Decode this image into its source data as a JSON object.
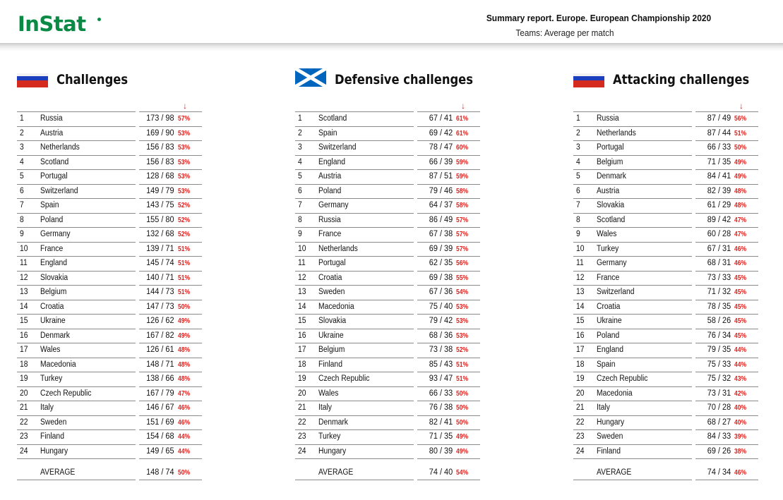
{
  "header": {
    "logo": "InStat",
    "title": "Summary report. Europe. European Championship 2020",
    "subtitle": "Teams: Average per match"
  },
  "colors": {
    "brand": "#0a8a44",
    "percent": "#e0201c",
    "rule": "#8a8a8a"
  },
  "sort_indicator": "↓",
  "panels": [
    {
      "title": "Challenges",
      "flag": "russia-flag",
      "rows": [
        {
          "rank": "1",
          "team": "Russia",
          "value": "173 / 98",
          "pct": "57%"
        },
        {
          "rank": "2",
          "team": "Austria",
          "value": "169 / 90",
          "pct": "53%"
        },
        {
          "rank": "3",
          "team": "Netherlands",
          "value": "156 / 83",
          "pct": "53%"
        },
        {
          "rank": "4",
          "team": "Scotland",
          "value": "156 / 83",
          "pct": "53%"
        },
        {
          "rank": "5",
          "team": "Portugal",
          "value": "128 / 68",
          "pct": "53%"
        },
        {
          "rank": "6",
          "team": "Switzerland",
          "value": "149 / 79",
          "pct": "53%"
        },
        {
          "rank": "7",
          "team": "Spain",
          "value": "143 / 75",
          "pct": "52%"
        },
        {
          "rank": "8",
          "team": "Poland",
          "value": "155 / 80",
          "pct": "52%"
        },
        {
          "rank": "9",
          "team": "Germany",
          "value": "132 / 68",
          "pct": "52%"
        },
        {
          "rank": "10",
          "team": "France",
          "value": "139 / 71",
          "pct": "51%"
        },
        {
          "rank": "11",
          "team": "England",
          "value": "145 / 74",
          "pct": "51%"
        },
        {
          "rank": "12",
          "team": "Slovakia",
          "value": "140 / 71",
          "pct": "51%"
        },
        {
          "rank": "13",
          "team": "Belgium",
          "value": "144 / 73",
          "pct": "51%"
        },
        {
          "rank": "14",
          "team": "Croatia",
          "value": "147 / 73",
          "pct": "50%"
        },
        {
          "rank": "15",
          "team": "Ukraine",
          "value": "126 / 62",
          "pct": "49%"
        },
        {
          "rank": "16",
          "team": "Denmark",
          "value": "167 / 82",
          "pct": "49%"
        },
        {
          "rank": "17",
          "team": "Wales",
          "value": "126 / 61",
          "pct": "48%"
        },
        {
          "rank": "18",
          "team": "Macedonia",
          "value": "148 / 71",
          "pct": "48%"
        },
        {
          "rank": "19",
          "team": "Turkey",
          "value": "138 / 66",
          "pct": "48%"
        },
        {
          "rank": "20",
          "team": "Czech Republic",
          "value": "167 / 79",
          "pct": "47%"
        },
        {
          "rank": "21",
          "team": "Italy",
          "value": "146 / 67",
          "pct": "46%"
        },
        {
          "rank": "22",
          "team": "Sweden",
          "value": "151 / 69",
          "pct": "46%"
        },
        {
          "rank": "23",
          "team": "Finland",
          "value": "154 / 68",
          "pct": "44%"
        },
        {
          "rank": "24",
          "team": "Hungary",
          "value": "149 / 65",
          "pct": "44%"
        }
      ],
      "average": {
        "label": "AVERAGE",
        "value": "148 / 74",
        "pct": "50%"
      }
    },
    {
      "title": "Defensive challenges",
      "flag": "scotland-flag",
      "rows": [
        {
          "rank": "1",
          "team": "Scotland",
          "value": "67 / 41",
          "pct": "61%"
        },
        {
          "rank": "2",
          "team": "Spain",
          "value": "69 / 42",
          "pct": "61%"
        },
        {
          "rank": "3",
          "team": "Switzerland",
          "value": "78 / 47",
          "pct": "60%"
        },
        {
          "rank": "4",
          "team": "England",
          "value": "66 / 39",
          "pct": "59%"
        },
        {
          "rank": "5",
          "team": "Austria",
          "value": "87 / 51",
          "pct": "59%"
        },
        {
          "rank": "6",
          "team": "Poland",
          "value": "79 / 46",
          "pct": "58%"
        },
        {
          "rank": "7",
          "team": "Germany",
          "value": "64 / 37",
          "pct": "58%"
        },
        {
          "rank": "8",
          "team": "Russia",
          "value": "86 / 49",
          "pct": "57%"
        },
        {
          "rank": "9",
          "team": "France",
          "value": "67 / 38",
          "pct": "57%"
        },
        {
          "rank": "10",
          "team": "Netherlands",
          "value": "69 / 39",
          "pct": "57%"
        },
        {
          "rank": "11",
          "team": "Portugal",
          "value": "62 / 35",
          "pct": "56%"
        },
        {
          "rank": "12",
          "team": "Croatia",
          "value": "69 / 38",
          "pct": "55%"
        },
        {
          "rank": "13",
          "team": "Sweden",
          "value": "67 / 36",
          "pct": "54%"
        },
        {
          "rank": "14",
          "team": "Macedonia",
          "value": "75 / 40",
          "pct": "53%"
        },
        {
          "rank": "15",
          "team": "Slovakia",
          "value": "79 / 42",
          "pct": "53%"
        },
        {
          "rank": "16",
          "team": "Ukraine",
          "value": "68 / 36",
          "pct": "53%"
        },
        {
          "rank": "17",
          "team": "Belgium",
          "value": "73 / 38",
          "pct": "52%"
        },
        {
          "rank": "18",
          "team": "Finland",
          "value": "85 / 43",
          "pct": "51%"
        },
        {
          "rank": "19",
          "team": "Czech Republic",
          "value": "93 / 47",
          "pct": "51%"
        },
        {
          "rank": "20",
          "team": "Wales",
          "value": "66 / 33",
          "pct": "50%"
        },
        {
          "rank": "21",
          "team": "Italy",
          "value": "76 / 38",
          "pct": "50%"
        },
        {
          "rank": "22",
          "team": "Denmark",
          "value": "82 / 41",
          "pct": "50%"
        },
        {
          "rank": "23",
          "team": "Turkey",
          "value": "71 / 35",
          "pct": "49%"
        },
        {
          "rank": "24",
          "team": "Hungary",
          "value": "80 / 39",
          "pct": "49%"
        }
      ],
      "average": {
        "label": "AVERAGE",
        "value": "74 / 40",
        "pct": "54%"
      }
    },
    {
      "title": "Attacking challenges",
      "flag": "russia-flag",
      "rows": [
        {
          "rank": "1",
          "team": "Russia",
          "value": "87 / 49",
          "pct": "56%"
        },
        {
          "rank": "2",
          "team": "Netherlands",
          "value": "87 / 44",
          "pct": "51%"
        },
        {
          "rank": "3",
          "team": "Portugal",
          "value": "66 / 33",
          "pct": "50%"
        },
        {
          "rank": "4",
          "team": "Belgium",
          "value": "71 / 35",
          "pct": "49%"
        },
        {
          "rank": "5",
          "team": "Denmark",
          "value": "84 / 41",
          "pct": "49%"
        },
        {
          "rank": "6",
          "team": "Austria",
          "value": "82 / 39",
          "pct": "48%"
        },
        {
          "rank": "7",
          "team": "Slovakia",
          "value": "61 / 29",
          "pct": "48%"
        },
        {
          "rank": "8",
          "team": "Scotland",
          "value": "89 / 42",
          "pct": "47%"
        },
        {
          "rank": "9",
          "team": "Wales",
          "value": "60 / 28",
          "pct": "47%"
        },
        {
          "rank": "10",
          "team": "Turkey",
          "value": "67 / 31",
          "pct": "46%"
        },
        {
          "rank": "11",
          "team": "Germany",
          "value": "68 / 31",
          "pct": "46%"
        },
        {
          "rank": "12",
          "team": "France",
          "value": "73 / 33",
          "pct": "45%"
        },
        {
          "rank": "13",
          "team": "Switzerland",
          "value": "71 / 32",
          "pct": "45%"
        },
        {
          "rank": "14",
          "team": "Croatia",
          "value": "78 / 35",
          "pct": "45%"
        },
        {
          "rank": "15",
          "team": "Ukraine",
          "value": "58 / 26",
          "pct": "45%"
        },
        {
          "rank": "16",
          "team": "Poland",
          "value": "76 / 34",
          "pct": "45%"
        },
        {
          "rank": "17",
          "team": "England",
          "value": "79 / 35",
          "pct": "44%"
        },
        {
          "rank": "18",
          "team": "Spain",
          "value": "75 / 33",
          "pct": "44%"
        },
        {
          "rank": "19",
          "team": "Czech Republic",
          "value": "75 / 32",
          "pct": "43%"
        },
        {
          "rank": "20",
          "team": "Macedonia",
          "value": "73 / 31",
          "pct": "42%"
        },
        {
          "rank": "21",
          "team": "Italy",
          "value": "70 / 28",
          "pct": "40%"
        },
        {
          "rank": "22",
          "team": "Hungary",
          "value": "68 / 27",
          "pct": "40%"
        },
        {
          "rank": "23",
          "team": "Sweden",
          "value": "84 / 33",
          "pct": "39%"
        },
        {
          "rank": "24",
          "team": "Finland",
          "value": "69 / 26",
          "pct": "38%"
        }
      ],
      "average": {
        "label": "AVERAGE",
        "value": "74 / 34",
        "pct": "46%"
      }
    }
  ]
}
